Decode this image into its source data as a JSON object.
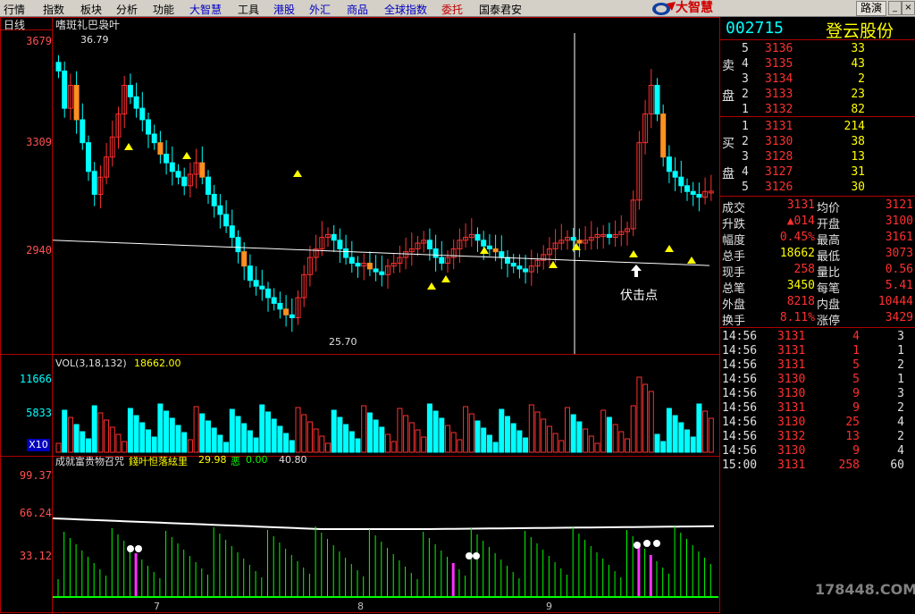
{
  "menu": [
    "行情",
    "指数",
    "板块",
    "分析",
    "功能",
    "大智慧",
    "工具",
    "港股",
    "外汇",
    "商品",
    "全球指数",
    "委托",
    "国泰君安"
  ],
  "menu_colors": [
    "#000",
    "#000",
    "#000",
    "#000",
    "#000",
    "#0000c0",
    "#000",
    "#0000c0",
    "#0000c0",
    "#0000c0",
    "#0000c0",
    "#c00000",
    "#000"
  ],
  "brand": "大智慧",
  "route_button": "路演",
  "main": {
    "period": "日线",
    "title": "嗜斑礼巴袅叶",
    "high_label": "36.79",
    "low_label": "25.70",
    "note": "伏击点",
    "y_ticks": [
      "3679",
      "3309",
      "2940"
    ]
  },
  "vol": {
    "title": "VOL(3,18,132)",
    "value": "18662.00",
    "y_ticks": [
      "11666",
      "5833"
    ],
    "unit": "X10"
  },
  "ind": {
    "title": "成就富贵物召咒",
    "title2": "錢叶怛落絃里",
    "v1": "29.98",
    "v2_label": "恶",
    "v2": "0.00",
    "v3": "40.80",
    "y_ticks": [
      "99.37",
      "66.24",
      "33.12"
    ]
  },
  "x_dates": [
    "7",
    "8",
    "9"
  ],
  "watermark": "178448.COM",
  "quote": {
    "code": "002715",
    "name": "登云股份",
    "sell_label": [
      "卖",
      "盘"
    ],
    "buy_label": [
      "买",
      "盘"
    ],
    "asks": [
      {
        "n": "5",
        "p": "3136",
        "v": "33"
      },
      {
        "n": "4",
        "p": "3135",
        "v": "43"
      },
      {
        "n": "3",
        "p": "3134",
        "v": "2"
      },
      {
        "n": "2",
        "p": "3133",
        "v": "23"
      },
      {
        "n": "1",
        "p": "3132",
        "v": "82"
      }
    ],
    "bids": [
      {
        "n": "1",
        "p": "3131",
        "v": "214"
      },
      {
        "n": "2",
        "p": "3130",
        "v": "38"
      },
      {
        "n": "3",
        "p": "3128",
        "v": "13"
      },
      {
        "n": "4",
        "p": "3127",
        "v": "31"
      },
      {
        "n": "5",
        "p": "3126",
        "v": "30"
      }
    ],
    "stats": [
      {
        "k1": "成交",
        "v1": "3131",
        "k2": "均价",
        "v2": "3121"
      },
      {
        "k1": "升跌",
        "v1": "▲014",
        "k2": "开盘",
        "v2": "3100"
      },
      {
        "k1": "幅度",
        "v1": "0.45%",
        "k2": "最高",
        "v2": "3161"
      },
      {
        "k1": "总手",
        "v1": "18662",
        "k2": "最低",
        "v2": "3073"
      },
      {
        "k1": "现手",
        "v1": "258",
        "k2": "量比",
        "v2": "0.56"
      },
      {
        "k1": "总笔",
        "v1": "3450",
        "k2": "每笔",
        "v2": "5.41"
      },
      {
        "k1": "外盘",
        "v1": "8218",
        "k2": "内盘",
        "v2": "10444"
      },
      {
        "k1": "换手",
        "v1": "8.11%",
        "k2": "涨停",
        "v2": "3429"
      }
    ],
    "ticks": [
      {
        "t": "14:56",
        "p": "3131",
        "v": "4",
        "n": "3"
      },
      {
        "t": "14:56",
        "p": "3131",
        "v": "1",
        "n": "1"
      },
      {
        "t": "14:56",
        "p": "3131",
        "v": "5",
        "n": "2"
      },
      {
        "t": "14:56",
        "p": "3130",
        "v": "5",
        "n": "1"
      },
      {
        "t": "14:56",
        "p": "3130",
        "v": "9",
        "n": "3"
      },
      {
        "t": "14:56",
        "p": "3131",
        "v": "9",
        "n": "2"
      },
      {
        "t": "14:56",
        "p": "3130",
        "v": "25",
        "n": "4"
      },
      {
        "t": "14:56",
        "p": "3132",
        "v": "13",
        "n": "2"
      },
      {
        "t": "14:56",
        "p": "3130",
        "v": "9",
        "n": "4"
      },
      {
        "t": "15:00",
        "p": "3131",
        "v": "258",
        "n": "60"
      }
    ]
  },
  "colors": {
    "up": "#ff3030",
    "down": "#00ffff",
    "ma": "#ffffff",
    "vol_up": "#ff3030",
    "vol_down": "#00ffff",
    "green": "#00ff00",
    "yellow": "#ffff00",
    "magenta": "#ff30ff"
  }
}
